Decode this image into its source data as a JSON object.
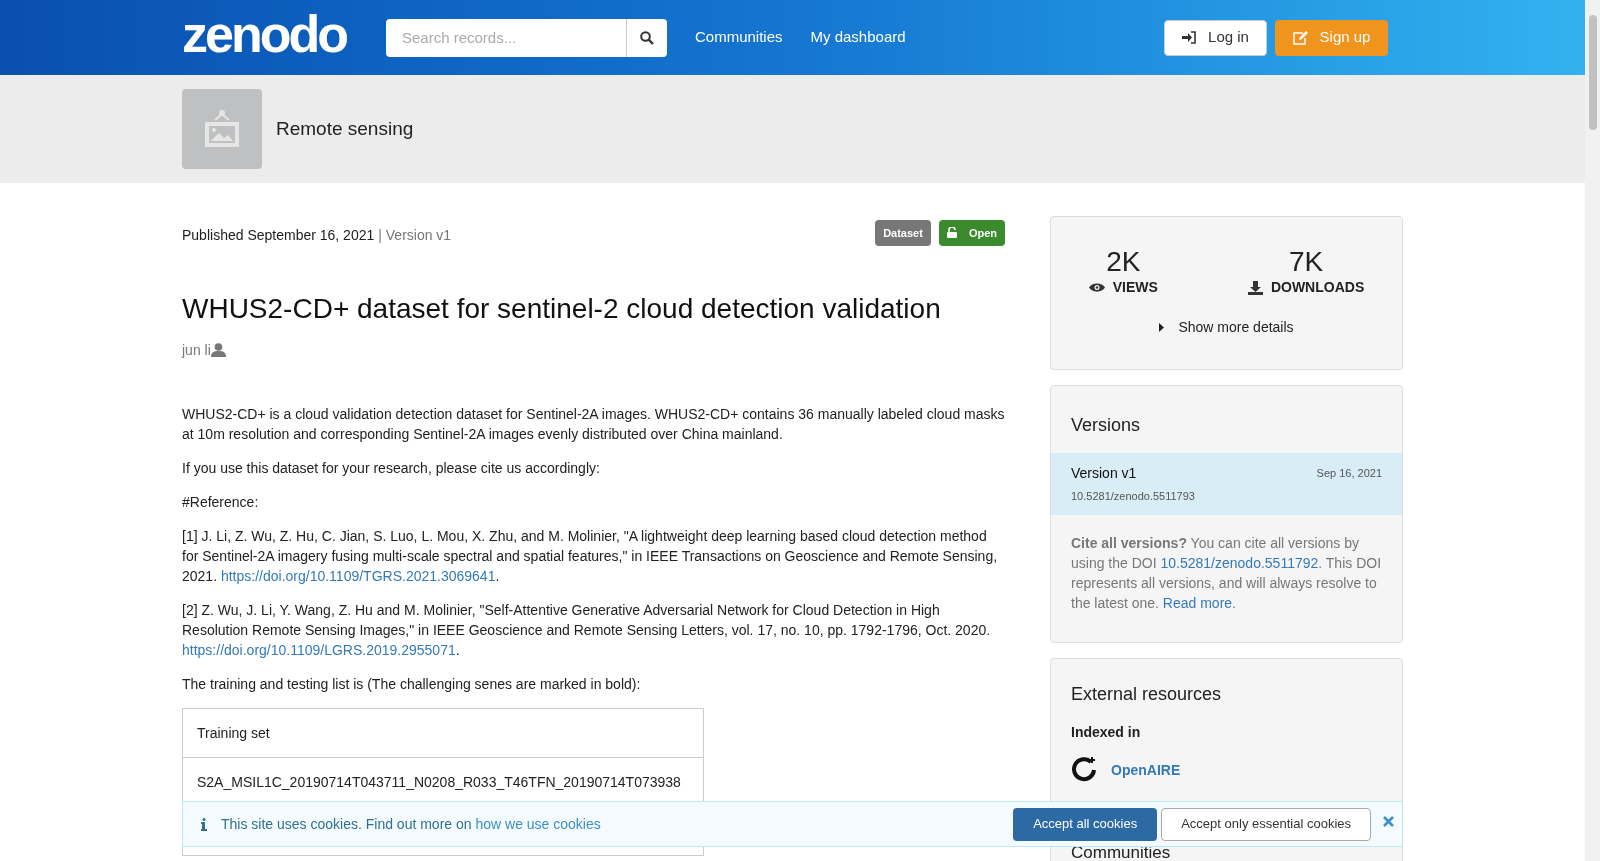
{
  "header": {
    "logo": "zenodo",
    "search": {
      "placeholder": "Search records..."
    },
    "nav": [
      "Communities",
      "My dashboard"
    ],
    "login": "Log in",
    "signup": "Sign up"
  },
  "community": {
    "name": "Remote sensing"
  },
  "record": {
    "published": "Published September 16, 2021",
    "version": "| Version v1",
    "badges": [
      {
        "kind": "type",
        "label": "Dataset"
      },
      {
        "kind": "access",
        "label": "Open"
      }
    ],
    "title": "WHUS2-CD+ dataset for sentinel-2 cloud detection validation",
    "creator": "jun li",
    "paragraphs": [
      [
        {
          "text": "WHUS2-CD+ is a cloud validation detection dataset for Sentinel-2A images. WHUS2-CD+ contains 36 manually labeled cloud masks at 10m resolution and corresponding Sentinel-2A images evenly distributed over China mainland."
        }
      ],
      [
        {
          "text": "If you use this dataset for your research, please cite us accordingly:"
        }
      ],
      [
        {
          "text": "#Reference:"
        }
      ],
      [
        {
          "text": "[1] J. Li, Z. Wu, Z. Hu, C. Jian, S. Luo, L. Mou, X. Zhu, and M. Molinier, \"A lightweight deep learning based cloud detection method for Sentinel-2A imagery fusing multi-scale spectral and spatial features,\" in IEEE Transactions on Geoscience and Remote Sensing, 2021. "
        },
        {
          "link": "https://doi.org/10.1109/TGRS.2021.3069641"
        },
        {
          "text": "."
        }
      ],
      [
        {
          "text": "[2] Z. Wu, J. Li, Y. Wang, Z. Hu and M. Molinier, \"Self-Attentive Generative Adversarial Network for Cloud Detection in High Resolution Remote Sensing Images,\" in IEEE Geoscience and Remote Sensing Letters, vol. 17, no. 10, pp. 1792-1796, Oct. 2020. "
        },
        {
          "link": "https://doi.org/10.1109/LGRS.2019.2955071"
        },
        {
          "text": "."
        }
      ],
      [
        {
          "text": "The training and testing list is (The challenging senes are marked in bold):"
        }
      ]
    ],
    "table": [
      "Training set",
      "S2A_MSIL1C_20190714T043711_N0208_R033_T46TFN_20190714T073938"
    ]
  },
  "stats": {
    "views": "2K",
    "views_label": "VIEWS",
    "downloads": "7K",
    "downloads_label": "DOWNLOADS",
    "more": "Show more details"
  },
  "versions": {
    "title": "Versions",
    "items": [
      {
        "name": "Version v1",
        "date": "Sep 16, 2021",
        "doi": "10.5281/zenodo.5511793",
        "selected": true
      }
    ],
    "cite": [
      {
        "bold": "Cite all versions?"
      },
      {
        "text": " You can cite all versions by using the DOI "
      },
      {
        "link": "10.5281/zenodo.5511792"
      },
      {
        "text": ". This DOI represents all versions, and will always resolve to the latest one. "
      },
      {
        "link": "Read more"
      },
      {
        "text": "."
      }
    ]
  },
  "external": {
    "title": "External resources",
    "subtitle": "Indexed in",
    "items": [
      "OpenAIRE"
    ]
  },
  "communities": {
    "title": "Communities"
  },
  "cookies": {
    "text": "This site uses cookies. Find out more on ",
    "link": "how we use cookies",
    "accept_all": "Accept all cookies",
    "accept_essential": "Accept only essential cookies"
  }
}
